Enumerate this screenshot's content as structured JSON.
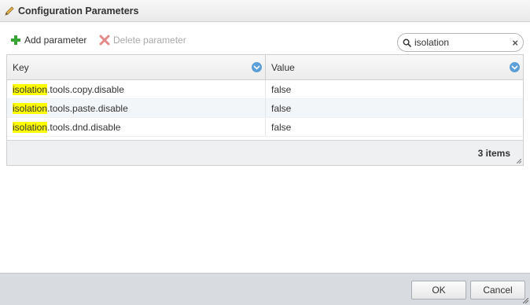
{
  "window": {
    "title": "Configuration Parameters",
    "icon": "pencil-icon"
  },
  "toolbar": {
    "add_label": "Add parameter",
    "add_icon": "plus-icon",
    "delete_label": "Delete parameter",
    "delete_icon": "x-icon"
  },
  "search": {
    "value": "isolation",
    "icon": "search-icon",
    "clear": "×"
  },
  "grid": {
    "columns": [
      {
        "label": "Key"
      },
      {
        "label": "Value"
      }
    ],
    "rows": [
      {
        "key_match": "isolation",
        "key_rest": ".tools.copy.disable",
        "value": "false"
      },
      {
        "key_match": "isolation",
        "key_rest": ".tools.paste.disable",
        "value": "false"
      },
      {
        "key_match": "isolation",
        "key_rest": ".tools.dnd.disable",
        "value": "false"
      }
    ],
    "footer": "3 items"
  },
  "buttons": {
    "ok": "OK",
    "cancel": "Cancel"
  },
  "colors": {
    "highlight": "#ffff00",
    "accent": "#5a9fd8",
    "add_green": "#3aa335",
    "delete_red": "#e58a8a"
  }
}
